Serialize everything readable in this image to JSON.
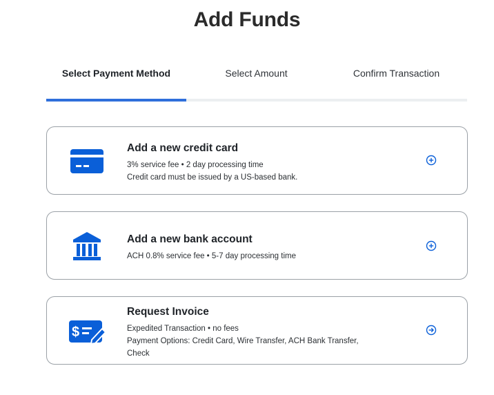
{
  "page": {
    "title": "Add Funds"
  },
  "steps": {
    "items": [
      {
        "label": "Select Payment Method"
      },
      {
        "label": "Select Amount"
      },
      {
        "label": "Confirm Transaction"
      }
    ],
    "active_index": 0,
    "progress_fraction": 0.333
  },
  "options": [
    {
      "title": "Add a new credit card",
      "lines": [
        "3% service fee • 2 day processing time",
        "Credit card must be issued by a US-based bank."
      ],
      "icon": "credit-card-icon",
      "action_icon": "plus-circle-icon"
    },
    {
      "title": "Add a new bank account",
      "lines": [
        "ACH 0.8% service fee • 5-7 day processing time"
      ],
      "icon": "bank-icon",
      "action_icon": "plus-circle-icon"
    },
    {
      "title": "Request Invoice",
      "lines": [
        "Expedited Transaction • no fees",
        "Payment Options: Credit Card, Wire Transfer, ACH Bank Transfer,",
        "Check"
      ],
      "icon": "invoice-icon",
      "action_icon": "arrow-right-circle-icon"
    }
  ],
  "colors": {
    "accent": "#0a5fd8",
    "progress": "#2f6fdb",
    "track": "#eceff1",
    "border": "#9aa0a6"
  }
}
